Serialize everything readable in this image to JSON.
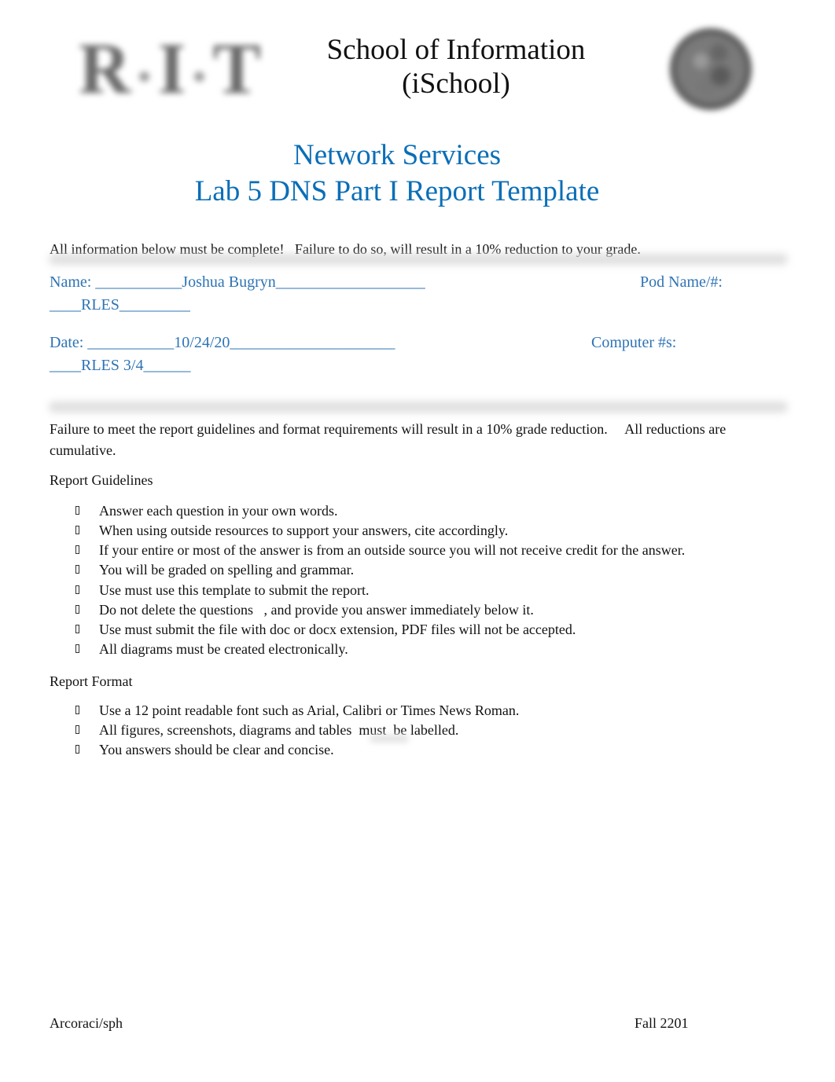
{
  "header": {
    "logo_text": "R·I·T",
    "logo_letters": [
      "R",
      "I",
      "T"
    ],
    "school_line1": "School of Information",
    "school_line2": "(iSchool)"
  },
  "title": {
    "line1": "Network Services",
    "line2": "Lab 5 DNS Part I Report Template"
  },
  "notice": "All information below must be complete!   Failure to do so, will result in a 10% reduction to your grade.",
  "form": {
    "name_label": "Name:",
    "name_line": "Name: ___________Joshua Bugryn___________________",
    "name_value": "Joshua Bugryn",
    "pod_label": "Pod Name/#:",
    "pod_line": "____RLES_________",
    "pod_value": "RLES",
    "date_label": "Date:",
    "date_line": "Date: ___________10/24/20_____________________",
    "date_value": "10/24/20",
    "computer_label": "Computer #s:",
    "computer_line": "____RLES 3/4______",
    "computer_value": "RLES 3/4"
  },
  "guidelines_note": {
    "sentence1": "Failure to meet the report guidelines and format requirements will result in a 10% grade reduction.",
    "sentence2": "All reductions are cumulative."
  },
  "report_guidelines": {
    "heading": "Report Guidelines",
    "items": [
      "Answer each question in your own words.",
      "When using outside resources to support your answers, cite accordingly.",
      "If your entire or most of the answer is from an outside source you will not receive credit for the answer.",
      "You will be graded on spelling and grammar.",
      "Use must use this template to submit the report.",
      "Do not delete the questions   , and provide you answer immediately below it.",
      "Use must submit the file with doc or docx extension, PDF files will not be accepted.",
      "All diagrams must be created electronically."
    ]
  },
  "report_format": {
    "heading": "Report Format",
    "items": [
      "Use a 12 point readable font such as Arial, Calibri or Times News Roman.",
      "All figures, screenshots, diagrams and tables  must  be labelled.",
      "You answers should be clear and concise."
    ]
  },
  "footer": {
    "left": "Arcoraci/sph",
    "right": "Fall 2201"
  },
  "colors": {
    "title_blue": "#0a6eb7",
    "field_blue": "#2e74b5",
    "text": "#111111"
  }
}
